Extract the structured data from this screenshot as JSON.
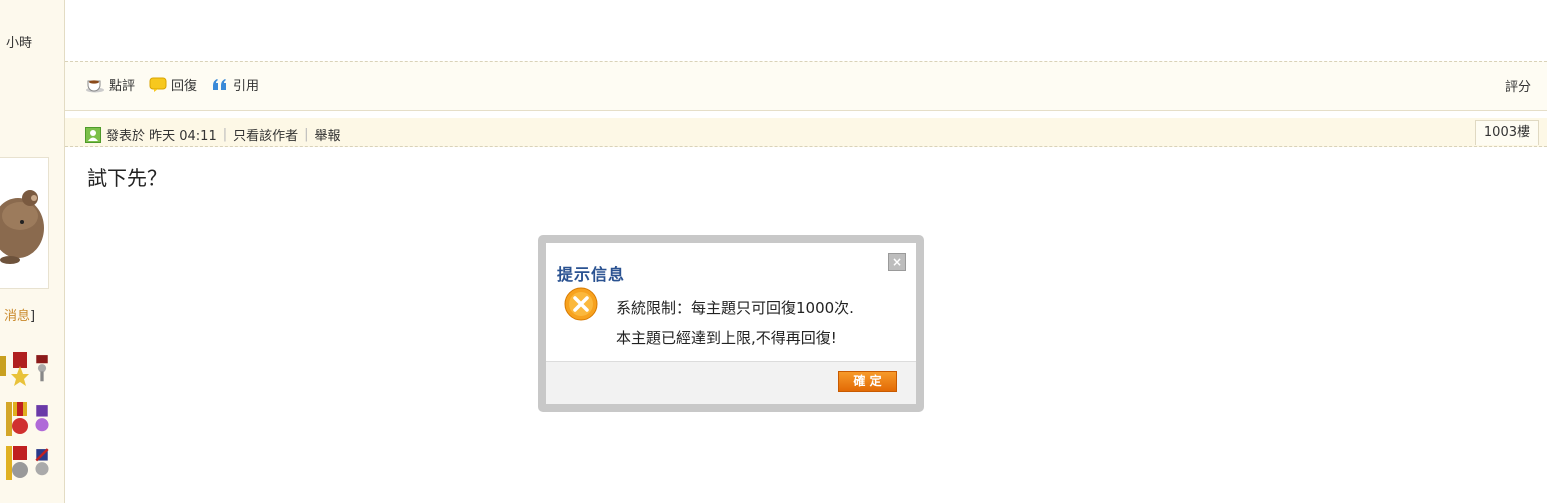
{
  "left_column": {
    "hours_text": "小時",
    "msg_prefix": "",
    "msg_text": "消息",
    "msg_suffix": "]"
  },
  "action_bar": {
    "comment_label": "點評",
    "reply_label": "回復",
    "quote_label": "引用",
    "rate_label": "評分"
  },
  "post": {
    "posted_label": "發表於 昨天 04:11",
    "author_only_label": "只看該作者",
    "report_label": "舉報",
    "floor_label": "1003樓",
    "content_text": "試下先？"
  },
  "dialog": {
    "title": "提示信息",
    "close_symbol": "×",
    "message_line1": "系統限制：每主題只可回復1000次.",
    "message_line2": "本主題已經達到上限,不得再回復!",
    "ok_label": "確 定"
  },
  "colors": {
    "dialog_title": "#2a5291",
    "ok_button": "#f08a1a",
    "error_icon": "#f7a21e"
  }
}
